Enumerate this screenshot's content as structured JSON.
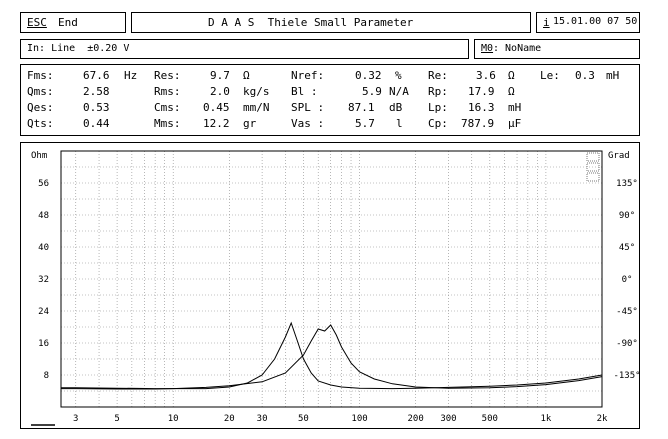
{
  "header": {
    "esc_key": "ESC",
    "esc_label": "End",
    "title": "D A A S  Thiele Small Parameter",
    "info_key": "i",
    "datetime": "15.01.00 07 50"
  },
  "input_bar": {
    "input_label": "In: Line  ±0.20 V",
    "memory_key": "M0",
    "memory_label": ": NoName"
  },
  "params": {
    "row1": [
      {
        "name": "Fms:",
        "value": "67.6",
        "unit": "Hz"
      },
      {
        "name": "Res:",
        "value": "9.7",
        "unit": "Ω"
      },
      {
        "name": "Nref:",
        "value": "0.32",
        "unit": "%"
      },
      {
        "name": "Re:",
        "value": "3.6",
        "unit": "Ω"
      },
      {
        "name": "Le:",
        "value": "0.3",
        "unit": "mH"
      }
    ],
    "row2": [
      {
        "name": "Qms:",
        "value": "2.58",
        "unit": ""
      },
      {
        "name": "Rms:",
        "value": "2.0",
        "unit": "kg/s"
      },
      {
        "name": "Bl :",
        "value": "5.9",
        "unit": "N/A"
      },
      {
        "name": "Rp:",
        "value": "17.9",
        "unit": "Ω"
      }
    ],
    "row3": [
      {
        "name": "Qes:",
        "value": "0.53",
        "unit": ""
      },
      {
        "name": "Cms:",
        "value": "0.45",
        "unit": "mm/N"
      },
      {
        "name": "SPL :",
        "value": "87.1",
        "unit": "dB"
      },
      {
        "name": "Lp:",
        "value": "16.3",
        "unit": "mH"
      }
    ],
    "row4": [
      {
        "name": "Qts:",
        "value": "0.44",
        "unit": ""
      },
      {
        "name": "Mms:",
        "value": "12.2",
        "unit": "gr"
      },
      {
        "name": "Vas :",
        "value": "5.7",
        "unit": "l"
      },
      {
        "name": "Cp:",
        "value": "787.9",
        "unit": "µF"
      }
    ]
  },
  "chart_data": {
    "type": "line",
    "x_scale": "log",
    "xlim": [
      2.5,
      2000
    ],
    "x_ticks": [
      "3",
      "5",
      "10",
      "20",
      "30",
      "50",
      "100",
      "200",
      "300",
      "500",
      "1k",
      "2k"
    ],
    "x_tick_values": [
      3,
      5,
      10,
      20,
      30,
      50,
      100,
      200,
      300,
      500,
      1000,
      2000
    ],
    "ylabel_left": "Ohm",
    "ylim_left": [
      0,
      64
    ],
    "y_ticks_left": [
      "56",
      "48",
      "40",
      "32",
      "24",
      "16",
      "8"
    ],
    "y_tick_values_left": [
      56,
      48,
      40,
      32,
      24,
      16,
      8
    ],
    "ylabel_right": "Grad",
    "ylim_right": [
      -180,
      180
    ],
    "y_ticks_right": [
      "135°",
      "90°",
      "45°",
      "0°",
      "-45°",
      "-90°",
      "-135°"
    ],
    "y_tick_values_right": [
      135,
      90,
      45,
      0,
      -45,
      -90,
      -135
    ],
    "grid": true,
    "series": [
      {
        "axis": "left",
        "x": [
          2.5,
          3,
          5,
          8,
          10,
          15,
          20,
          25,
          30,
          35,
          40,
          43,
          46,
          50,
          55,
          60,
          70,
          80,
          100,
          150,
          200,
          300,
          500,
          700,
          1000,
          1500,
          2000
        ],
        "y": [
          4.8,
          4.8,
          4.7,
          4.6,
          4.6,
          4.6,
          5.0,
          6.0,
          8.0,
          12.0,
          17.5,
          21.0,
          17.0,
          12.0,
          8.5,
          6.5,
          5.5,
          5.0,
          4.7,
          4.6,
          4.7,
          4.9,
          5.2,
          5.5,
          6.0,
          7.0,
          8.0
        ]
      },
      {
        "axis": "left",
        "x": [
          2.5,
          3,
          5,
          8,
          10,
          15,
          20,
          30,
          40,
          50,
          55,
          60,
          65,
          70,
          75,
          80,
          90,
          100,
          120,
          150,
          200,
          300,
          500,
          700,
          1000,
          1500,
          2000
        ],
        "y": [
          4.6,
          4.6,
          4.5,
          4.5,
          4.6,
          4.9,
          5.3,
          6.3,
          8.5,
          13.0,
          16.5,
          19.5,
          19.0,
          20.5,
          18.0,
          15.0,
          11.0,
          8.8,
          7.0,
          5.8,
          5.0,
          4.7,
          4.8,
          5.1,
          5.6,
          6.6,
          7.6
        ]
      }
    ]
  }
}
